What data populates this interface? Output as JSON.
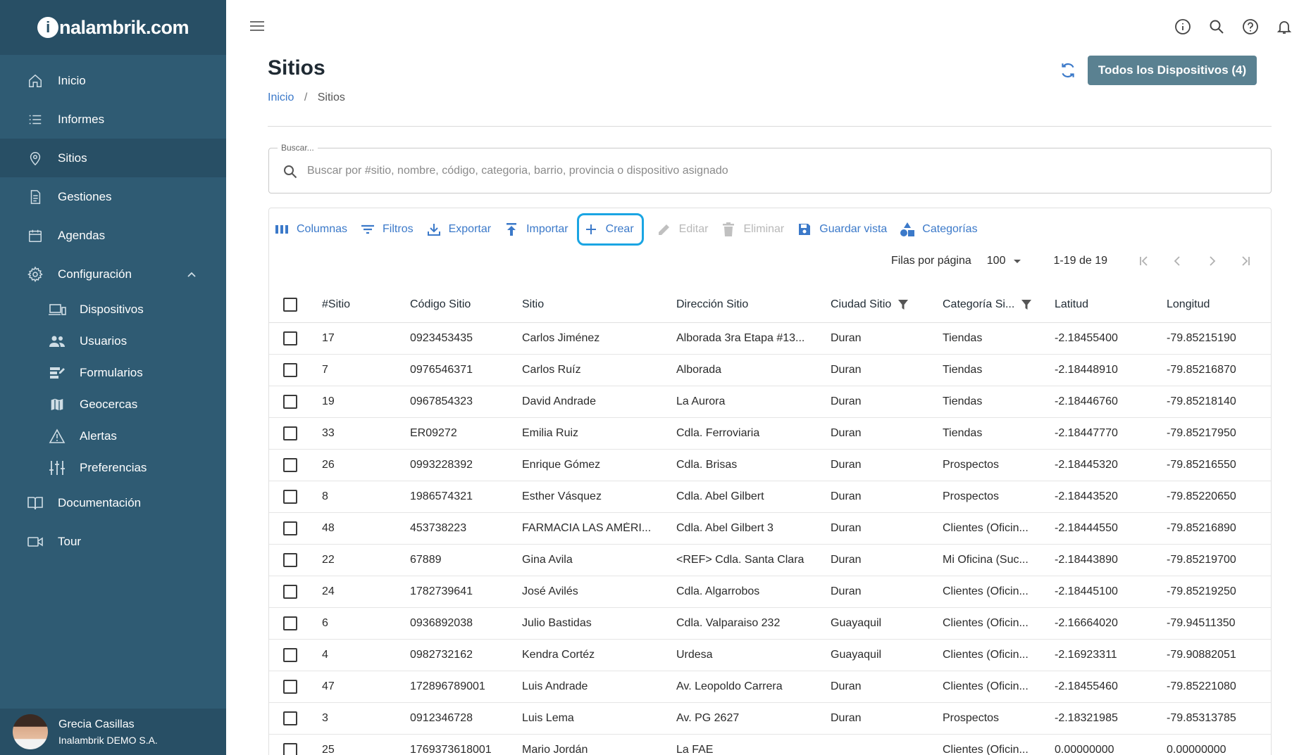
{
  "app": {
    "logo_letter": "i",
    "logo_text": "nalambrik.com"
  },
  "sidebar": {
    "items": [
      {
        "label": "Inicio",
        "icon": "home-icon"
      },
      {
        "label": "Informes",
        "icon": "list-icon"
      },
      {
        "label": "Sitios",
        "icon": "location-pin-icon",
        "active": true
      },
      {
        "label": "Gestiones",
        "icon": "document-icon"
      },
      {
        "label": "Agendas",
        "icon": "calendar-icon"
      },
      {
        "label": "Configuración",
        "icon": "gear-icon",
        "expanded": true
      }
    ],
    "sub_items": [
      {
        "label": "Dispositivos",
        "icon": "devices-icon"
      },
      {
        "label": "Usuarios",
        "icon": "users-icon"
      },
      {
        "label": "Formularios",
        "icon": "forms-icon"
      },
      {
        "label": "Geocercas",
        "icon": "map-icon"
      },
      {
        "label": "Alertas",
        "icon": "warning-icon"
      },
      {
        "label": "Preferencias",
        "icon": "sliders-icon"
      }
    ],
    "bottom_items": [
      {
        "label": "Documentación",
        "icon": "book-icon"
      },
      {
        "label": "Tour",
        "icon": "video-icon"
      }
    ],
    "user": {
      "name": "Grecia Casillas",
      "org": "Inalambrik DEMO S.A."
    }
  },
  "header": {
    "title": "Sitios",
    "breadcrumb": {
      "home": "Inicio",
      "separator": "/",
      "current": "Sitios"
    },
    "all_devices_button": "Todos los Dispositivos (4)"
  },
  "search": {
    "legend": "Buscar...",
    "placeholder": "Buscar por #sitio, nombre, código, categoria, barrio, provincia o dispositivo asignado",
    "value": ""
  },
  "toolbar": {
    "columns": "Columnas",
    "filters": "Filtros",
    "export": "Exportar",
    "import": "Importar",
    "create": "Crear",
    "edit": "Editar",
    "delete": "Eliminar",
    "save_view": "Guardar vista",
    "categories": "Categorías"
  },
  "pager": {
    "rows_label": "Filas por página",
    "rows_value": "100",
    "range": "1-19 de 19"
  },
  "table": {
    "columns": [
      "#Sitio",
      "Código Sitio",
      "Sitio",
      "Dirección Sitio",
      "Ciudad Sitio",
      "Categoría Si...",
      "Latitud",
      "Longitud"
    ],
    "rows": [
      [
        "17",
        "0923453435",
        "Carlos Jiménez",
        "Alborada 3ra Etapa #13...",
        "Duran",
        "Tiendas",
        "-2.18455400",
        "-79.85215190"
      ],
      [
        "7",
        "0976546371",
        "Carlos Ruíz",
        "Alborada",
        "Duran",
        "Tiendas",
        "-2.18448910",
        "-79.85216870"
      ],
      [
        "19",
        "0967854323",
        "David Andrade",
        "La Aurora",
        "Duran",
        "Tiendas",
        "-2.18446760",
        "-79.85218140"
      ],
      [
        "33",
        "ER09272",
        "Emilia Ruiz",
        "Cdla. Ferroviaria",
        "Duran",
        "Tiendas",
        "-2.18447770",
        "-79.85217950"
      ],
      [
        "26",
        "0993228392",
        "Enrique Gómez",
        "Cdla. Brisas",
        "Duran",
        "Prospectos",
        "-2.18445320",
        "-79.85216550"
      ],
      [
        "8",
        "1986574321",
        "Esther Vásquez",
        "Cdla. Abel Gilbert",
        "Duran",
        "Prospectos",
        "-2.18443520",
        "-79.85220650"
      ],
      [
        "48",
        "453738223",
        "FARMACIA LAS AMÉRI...",
        "Cdla. Abel Gilbert 3",
        "Duran",
        "Clientes (Oficin...",
        "-2.18444550",
        "-79.85216890"
      ],
      [
        "22",
        "67889",
        "Gina Avila",
        "<REF> Cdla. Santa Clara",
        "Duran",
        "Mi Oficina (Suc...",
        "-2.18443890",
        "-79.85219700"
      ],
      [
        "24",
        "1782739641",
        "José Avilés",
        "Cdla. Algarrobos",
        "Duran",
        "Clientes (Oficin...",
        "-2.18445100",
        "-79.85219250"
      ],
      [
        "6",
        "0936892038",
        "Julio Bastidas",
        "Cdla. Valparaiso 232",
        "Guayaquil",
        "Clientes (Oficin...",
        "-2.16664020",
        "-79.94511350"
      ],
      [
        "4",
        "0982732162",
        "Kendra Cortéz",
        "Urdesa",
        "Guayaquil",
        "Clientes (Oficin...",
        "-2.16923311",
        "-79.90882051"
      ],
      [
        "47",
        "172896789001",
        "Luis Andrade",
        "Av. Leopoldo Carrera",
        "Duran",
        "Clientes (Oficin...",
        "-2.18455460",
        "-79.85221080"
      ],
      [
        "3",
        "0912346728",
        "Luis Lema",
        "Av. PG 2627",
        "Duran",
        "Prospectos",
        "-2.18321985",
        "-79.85313785"
      ],
      [
        "25",
        "1769373618001",
        "Mario Jordán",
        "La FAE",
        "",
        "Clientes (Oficin...",
        "0.00000000",
        "0.00000000"
      ]
    ]
  },
  "colors": {
    "sidebar_bg": "#2f5b73",
    "sidebar_active": "#284f65",
    "accent_link": "#3b79c9",
    "primary_button": "#5a8191",
    "highlight_ring": "#1aa5e3"
  }
}
